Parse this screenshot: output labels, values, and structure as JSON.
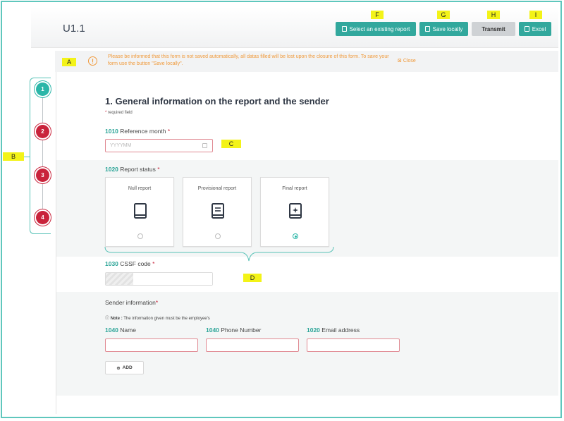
{
  "header": {
    "title": "U1.1",
    "buttons": {
      "select_report": "Select an existing report",
      "save_locally": "Save locally",
      "transmit": "Transmit",
      "excel": "Excel"
    }
  },
  "tags": {
    "a": "A",
    "b": "B",
    "c": "C",
    "d": "D",
    "f": "F",
    "g": "G",
    "h": "H",
    "i": "I"
  },
  "notice": {
    "icon": "!",
    "text": "Please be informed that this form is not saved automatically, all datas filled will be lost upon the closure of this form. To save your form use the button \"Save locally\".",
    "close": "Close"
  },
  "steps": [
    "1",
    "2",
    "3",
    "4"
  ],
  "section": {
    "title": "1. General information on the report and the sender",
    "required_star": "*",
    "required_note": "required field"
  },
  "reference_month": {
    "code": "1010",
    "label": "Reference month",
    "star": "*",
    "placeholder": "YYYYMM"
  },
  "report_status": {
    "code": "1020",
    "label": "Report status",
    "star": "*",
    "options": [
      {
        "label": "Null report",
        "selected": false
      },
      {
        "label": "Provisional report",
        "selected": false
      },
      {
        "label": "Final report",
        "selected": true
      }
    ]
  },
  "cssf_code": {
    "code": "1030",
    "label": "CSSF code",
    "star": "*"
  },
  "sender": {
    "title": "Sender information",
    "star": "*",
    "note_prefix": "Note :",
    "note": "The information given must be the employee's",
    "fields": [
      {
        "code": "1040",
        "label": "Name"
      },
      {
        "code": "1040",
        "label": "Phone Number"
      },
      {
        "code": "1020",
        "label": "Email address"
      }
    ],
    "add_label": "ADD"
  },
  "colors": {
    "accent": "#32a89d",
    "step_done": "#2bb6a8",
    "step_error": "#c9233b",
    "warning": "#f09a3b",
    "highlight": "#f3f318"
  }
}
